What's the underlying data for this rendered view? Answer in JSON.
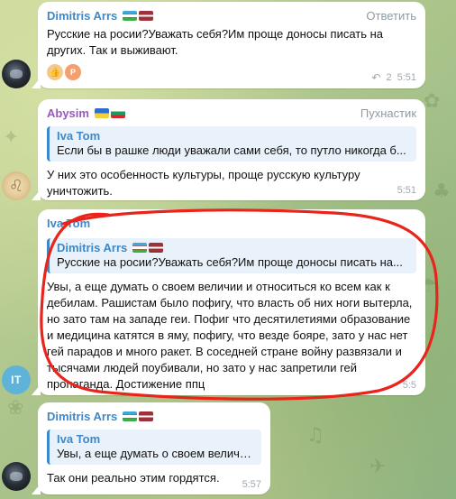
{
  "messages": [
    {
      "author": "Dimitris Arrs",
      "action": "Ответить",
      "text": "Русские на росии?Уважать себя?Им проще доносы писать на других. Так и выживают.",
      "reply_count": "2",
      "time": "5:51",
      "reactions": [
        "thumbs-up",
        "avatar-p"
      ],
      "reaction_avatar_letter": "P"
    },
    {
      "author": "Abysim",
      "action": "Пухнастик",
      "reply_to": {
        "author": "Iva Tom",
        "text": "Если бы в рашке люди уважали сами себя, то путло никогда б..."
      },
      "text": "У них это особенность культуры, проще русскую культуру уничтожить.",
      "time": "5:51"
    },
    {
      "author": "Iva Tom",
      "avatar_initials": "IT",
      "reply_to": {
        "author": "Dimitris Arrs",
        "text": "Русские на росии?Уважать себя?Им проще доносы писать на..."
      },
      "text": "Увы, а еще думать о своем величии и относиться ко всем как к дебилам. Рашистам было пофигу, что власть об них ноги вытерла, но зато там на западе геи. Пофиг что десятилетиями образование и медицина катятся в яму, пофигу, что везде бояре, зато у нас нет гей парадов и много ракет. В соседней стране войну развязали и тысячами людей поубивали, но зато у нас запретили гей пропаганда. Достижение ппц",
      "time": "5:5"
    },
    {
      "author": "Dimitris Arrs",
      "reply_to": {
        "author": "Iva Tom",
        "text": "Увы, а еще думать о своем величии..."
      },
      "text": "Так они реально этим гордятся.",
      "time": "5:57"
    }
  ],
  "colors": {
    "name_blue": "#3e88c9",
    "name_purple": "#9a56c2",
    "annotation_red": "#e8241b",
    "avatar_it": "#5fb3d8"
  }
}
